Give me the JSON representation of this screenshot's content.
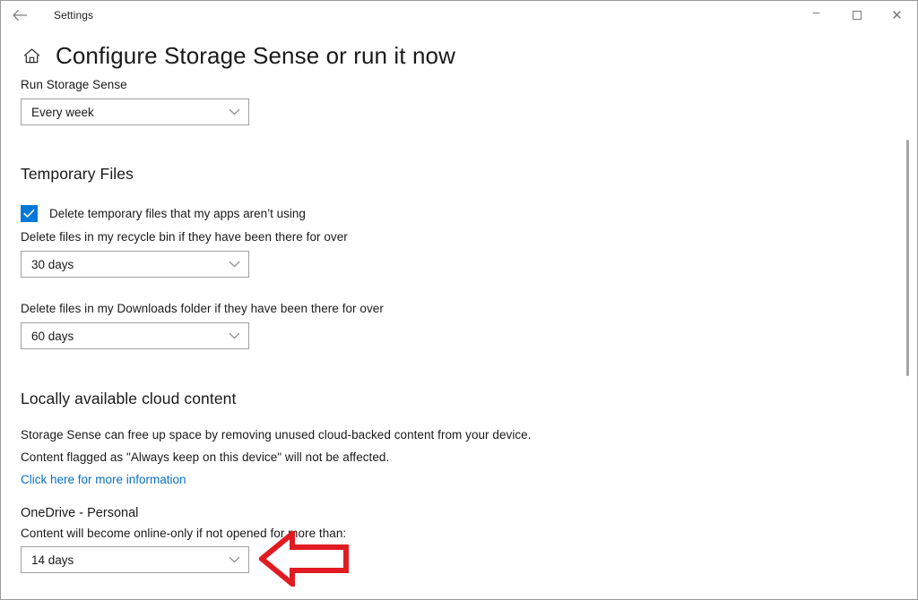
{
  "window": {
    "titlebar": {
      "back_icon": "back-arrow-icon",
      "app_title": "Settings",
      "minimize_label": "–",
      "maximize_label": "",
      "close_label": "✕"
    },
    "header": {
      "home_icon": "home-icon",
      "title": "Configure Storage Sense or run it now"
    }
  },
  "main": {
    "run_storage_sense": {
      "label": "Run Storage Sense",
      "dropdown_value": "Every week",
      "chevron_icon": "chevron-down-icon"
    },
    "temporary_files": {
      "heading": "Temporary Files",
      "checkbox": {
        "label": "Delete temporary files that my apps aren’t using",
        "checked": true,
        "check_glyph": "✓"
      },
      "recycle_bin": {
        "label": "Delete files in my recycle bin if they have been there for over",
        "dropdown_value": "30 days",
        "chevron_icon": "chevron-down-icon"
      },
      "downloads": {
        "label": "Delete files in my Downloads folder if they have been there for over",
        "dropdown_value": "60 days",
        "chevron_icon": "chevron-down-icon"
      }
    },
    "cloud_content": {
      "heading": "Locally available cloud content",
      "description_line1": "Storage Sense can free up space by removing unused cloud-backed content from your device.",
      "description_line2": "Content flagged as \"Always keep on this device\" will not be affected.",
      "more_info_link": "Click here for more information",
      "onedrive": {
        "heading": "OneDrive -  Personal",
        "label": "Content will become online-only if not opened for more than:",
        "dropdown_value": "14 days",
        "chevron_icon": "chevron-down-icon"
      }
    }
  },
  "annotation": {
    "arrow_icon": "left-arrow-annotation",
    "color": "#e01b22"
  },
  "colors": {
    "accent": "#0078d7",
    "link": "#0a70c4",
    "annotation_red": "#e01b22",
    "border": "#a0a0a0",
    "scrollbar": "#a6a6a6"
  }
}
